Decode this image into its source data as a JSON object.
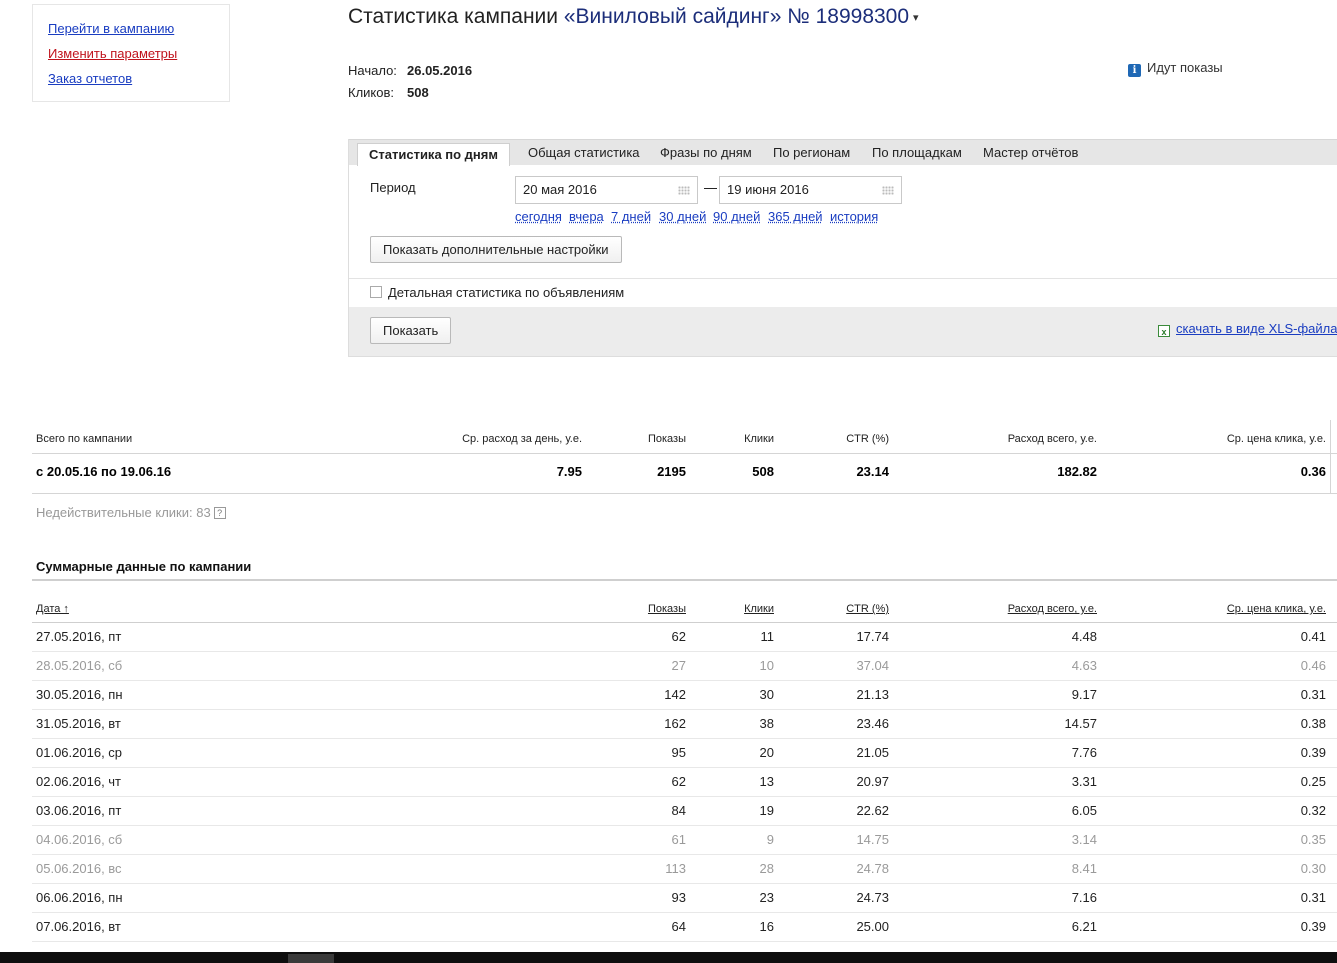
{
  "sidebar": {
    "links": [
      "Перейти в кампанию",
      "Изменить параметры",
      "Заказ отчетов"
    ]
  },
  "header": {
    "title_prefix": "Статистика кампании",
    "campaign": "«Виниловый сайдинг» № 18998300",
    "caret": "▾",
    "start_label": "Начало:",
    "start_value": "26.05.2016",
    "clicks_label": "Кликов:",
    "clicks_value": "508",
    "status_icon": "info-icon",
    "status": "Идут показы"
  },
  "tabs": [
    "Статистика по дням",
    "Общая статистика",
    "Фразы по дням",
    "По регионам",
    "По площадкам",
    "Мастер отчётов"
  ],
  "period": {
    "label": "Период",
    "from": "20 мая 2016",
    "dash": "—",
    "to": "19 июня 2016",
    "quick": [
      "сегодня",
      "вчера",
      "7 дней",
      "30 дней",
      "90 дней",
      "365 дней",
      "история"
    ]
  },
  "buttons": {
    "more_settings": "Показать дополнительные настройки",
    "show": "Показать"
  },
  "detail_checkbox": {
    "label": "Детальная статистика по объявлениям",
    "checked": false
  },
  "download": {
    "label": "скачать в виде XLS-файла",
    "icon": "excel-icon"
  },
  "totals": {
    "headers": [
      "Всего по кампании",
      "Ср. расход за день, у.е.",
      "Показы",
      "Клики",
      "CTR (%)",
      "Расход всего, у.е.",
      "Ср. цена клика, у.е."
    ],
    "row": [
      "с 20.05.16 по 19.06.16",
      "7.95",
      "2195",
      "508",
      "23.14",
      "182.82",
      "0.36"
    ]
  },
  "invalid_clicks": {
    "label": "Недействительные клики: 83",
    "help": "?"
  },
  "summary": {
    "title": "Суммарные данные по кампании",
    "headers": [
      "Дата ↑",
      "Показы",
      "Клики",
      "CTR (%)",
      "Расход всего, у.е.",
      "Ср. цена клика, у.е."
    ],
    "rows": [
      [
        "27.05.2016, пт",
        "62",
        "11",
        "17.74",
        "4.48",
        "0.41"
      ],
      [
        "28.05.2016, сб",
        "27",
        "10",
        "37.04",
        "4.63",
        "0.46"
      ],
      [
        "30.05.2016, пн",
        "142",
        "30",
        "21.13",
        "9.17",
        "0.31"
      ],
      [
        "31.05.2016, вт",
        "162",
        "38",
        "23.46",
        "14.57",
        "0.38"
      ],
      [
        "01.06.2016, ср",
        "95",
        "20",
        "21.05",
        "7.76",
        "0.39"
      ],
      [
        "02.06.2016, чт",
        "62",
        "13",
        "20.97",
        "3.31",
        "0.25"
      ],
      [
        "03.06.2016, пт",
        "84",
        "19",
        "22.62",
        "6.05",
        "0.32"
      ],
      [
        "04.06.2016, сб",
        "61",
        "9",
        "14.75",
        "3.14",
        "0.35"
      ],
      [
        "05.06.2016, вс",
        "113",
        "28",
        "24.78",
        "8.41",
        "0.30"
      ],
      [
        "06.06.2016, пн",
        "93",
        "23",
        "24.73",
        "7.16",
        "0.31"
      ],
      [
        "07.06.2016, вт",
        "64",
        "16",
        "25.00",
        "6.21",
        "0.39"
      ]
    ],
    "weekend_rows": [
      1,
      7,
      8
    ]
  },
  "colors": {
    "link": "#1a3dc1",
    "link_red": "#c0131c",
    "campaign": "#1c2e7a",
    "weekend_text": "#9a9a9a"
  }
}
